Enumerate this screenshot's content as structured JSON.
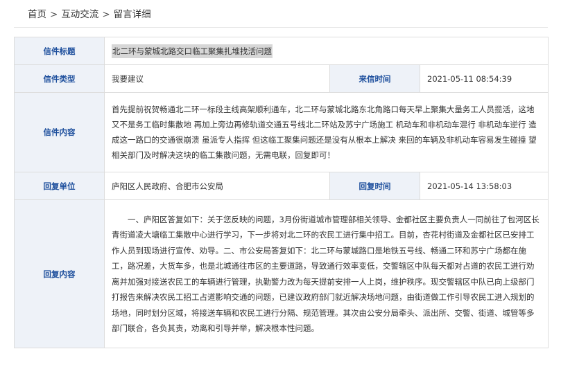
{
  "breadcrumb": {
    "home": "首页",
    "section": "互动交流",
    "current": "留言详细",
    "separator": ">"
  },
  "detail": {
    "subject_label": "信件标题",
    "subject": "北二环与蒙城北路交口临工聚集扎堆找活问题",
    "type_label": "信件类型",
    "type": "我要建议",
    "date_label": "来信时间",
    "date": "2021-05-11 08:54:39",
    "content_label": "信件内容",
    "content": "首先提前祝贺畅通北二环一标段主线高架顺利通车，北二环与蒙城北路东北角路口每天早上聚集大量务工人员揽活，这地又不是务工临时集散地 再加上旁边再修轨道交通五号线北二环站及苏宁广场施工 机动车和非机动车混行 非机动车逆行 造成这一路口的交通很崩溃 虽派专人指挥 但这临工聚集问题还是没有从根本上解决 来回的车辆及非机动车容易发生碰撞 望相关部门及时解决这块的临工集散问题，无需电联，回复即可！",
    "reply_unit_label": "回复单位",
    "reply_unit": "庐阳区人民政府、合肥市公安局",
    "reply_date_label": "回复时间",
    "reply_date": "2021-05-14 13:58:03",
    "reply_label": "回复内容",
    "reply": "一、庐阳区答复如下：关于您反映的问题，3月份街道城市管理部相关领导、金都社区主要负责人一同前往了包河区长青街道凌大塘临工集散中心进行学习，下一步将对北二环的农民工进行集中招工。目前，杏花村街道及金都社区已安排工作人员到现场进行宣传、劝导。二、市公安局答复如下：北二环与蒙城路口是地铁五号线、畅通二环和苏宁广场都在施工，路况差，大货车多，也是北城通往市区的主要道路，导致通行效率变低，交警辖区中队每天都对占道的农民工进行劝离并加强对接送农民工的车辆进行管理，执勤警力改为每天提前安排一人上岗，维护秩序。现交警辖区中队已向上级部门打报告来解决农民工招工占道影响交通的问题，已建议政府部门就近解决场地问题，由街道做工作引导农民工进入规划的场地，同时划分区域，将接送车辆和农民工进行分隔、规范管理。其次由公安分局牵头、派出所、交警、街道、城管等多部门联合，各负其责，劝离和引导并举，解决根本性问题。"
  }
}
